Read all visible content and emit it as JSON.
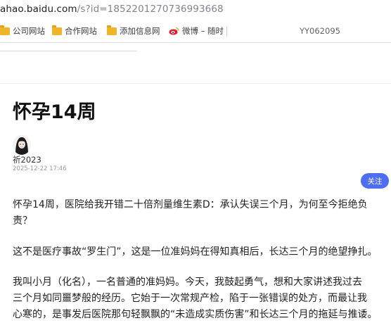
{
  "browser": {
    "url_host": "ahao.baidu.com",
    "url_path": "/s?id=1852201270736993668",
    "bookmarks": [
      {
        "label": "公司网站",
        "icon": "folder-icon"
      },
      {
        "label": "合作网站",
        "icon": "folder-icon"
      },
      {
        "label": "添加信息网",
        "icon": "folder-icon"
      },
      {
        "label": "微博 – 随时",
        "icon": "weibo-icon"
      }
    ],
    "tag": "YY062095"
  },
  "article": {
    "title": "怀孕14周",
    "author": "祈2023",
    "date": "2025-12-22 17:46",
    "follow_label": "关注",
    "paragraphs": [
      [
        "怀孕14周，医院给我开错二十倍剂量维生素D：承认失误三个月，为何至今拒绝负",
        "责？"
      ],
      [
        "这不是医疗事故“罗生门”，这是一位准妈妈在得知真相后，长达三个月的绝望挣扎。"
      ],
      [
        "我叫小月（化名），一名普通的准妈妈。今天，我鼓起勇气，想和大家讲述我过去",
        "三个月如同噩梦般的经历。它始于一次常规产检，陷于一张错误的处方，而最让我",
        "心寒的，是事发后医院那句轻飘飘的“未造成实质伤害”和长达三个月的拖延与推诿。"
      ]
    ]
  },
  "colors": {
    "accent": "#4e6ef2",
    "folder": "#f0b429"
  }
}
